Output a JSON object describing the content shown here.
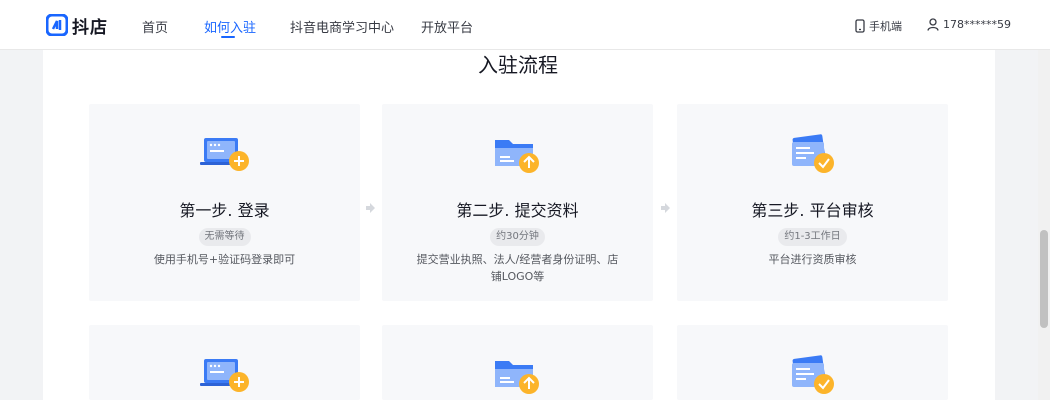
{
  "header": {
    "logo_text": "抖店",
    "nav": [
      {
        "label": "首页"
      },
      {
        "label": "如何入驻"
      },
      {
        "label": "抖音电商学习中心"
      },
      {
        "label": "开放平台"
      }
    ],
    "active_nav": "如何入驻",
    "mobile_label": "手机端",
    "user_phone": "178******59"
  },
  "section": {
    "title": "入驻流程"
  },
  "steps": [
    {
      "title": "第一步. 登录",
      "badge": "无需等待",
      "desc": "使用手机号+验证码登录即可",
      "icon": "laptop-plus-icon"
    },
    {
      "title": "第二步. 提交资料",
      "badge": "约30分钟",
      "desc": "提交营业执照、法人/经营者身份证明、店铺LOGO等",
      "icon": "folder-upload-icon"
    },
    {
      "title": "第三步. 平台审核",
      "badge": "约1-3工作日",
      "desc": "平台进行资质审核",
      "icon": "card-check-icon"
    }
  ],
  "colors": {
    "accent": "#1966ff",
    "orange": "#fcb42a",
    "icon_blue": "#3b7bf5"
  }
}
